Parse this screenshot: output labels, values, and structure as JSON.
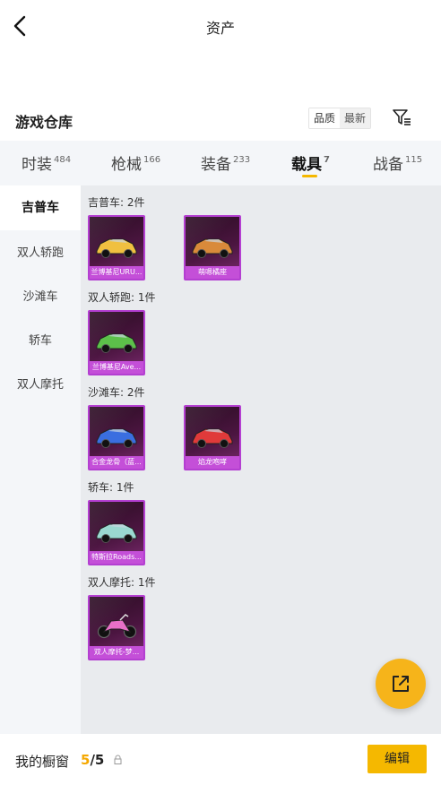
{
  "header": {
    "title": "资产",
    "back_icon": "chevron-left-icon"
  },
  "section": {
    "title": "游戏仓库",
    "sort_options": [
      "品质",
      "最新"
    ],
    "filter_icon": "filter-icon"
  },
  "tabs": [
    {
      "label": "时装",
      "count": "484",
      "active": false
    },
    {
      "label": "枪械",
      "count": "166",
      "active": false
    },
    {
      "label": "装备",
      "count": "233",
      "active": false
    },
    {
      "label": "载具",
      "count": "7",
      "active": true
    },
    {
      "label": "战备",
      "count": "115",
      "active": false
    }
  ],
  "accent_color": "#f5b800",
  "sidebar": {
    "items": [
      "吉普车",
      "双人轿跑",
      "沙滩车",
      "轿车",
      "双人摩托"
    ],
    "active_index": 0
  },
  "groups": [
    {
      "label": "吉普车: 2件",
      "items": [
        {
          "name": "兰博基尼URU...",
          "color": "#f0c040"
        },
        {
          "name": "萌嗯橘座",
          "color": "#d98a3a"
        }
      ]
    },
    {
      "label": "双人轿跑: 1件",
      "items": [
        {
          "name": "兰博基尼Ave...",
          "color": "#5cc04a"
        }
      ]
    },
    {
      "label": "沙滩车: 2件",
      "items": [
        {
          "name": "合金龙骨（蓝...",
          "color": "#3a6ee0"
        },
        {
          "name": "焰龙咆哮",
          "color": "#e03a3a"
        }
      ]
    },
    {
      "label": "轿车: 1件",
      "items": [
        {
          "name": "特斯拉Roads...",
          "color": "#9ad8d0"
        }
      ]
    },
    {
      "label": "双人摩托: 1件",
      "items": [
        {
          "name": "双人摩托-梦...",
          "color": "#e870c8"
        }
      ]
    }
  ],
  "fab_icon": "share-external-icon",
  "footer": {
    "label": "我的橱窗",
    "current": "5",
    "total": "/5",
    "lock_icon": "lock-icon",
    "edit_label": "编辑"
  }
}
